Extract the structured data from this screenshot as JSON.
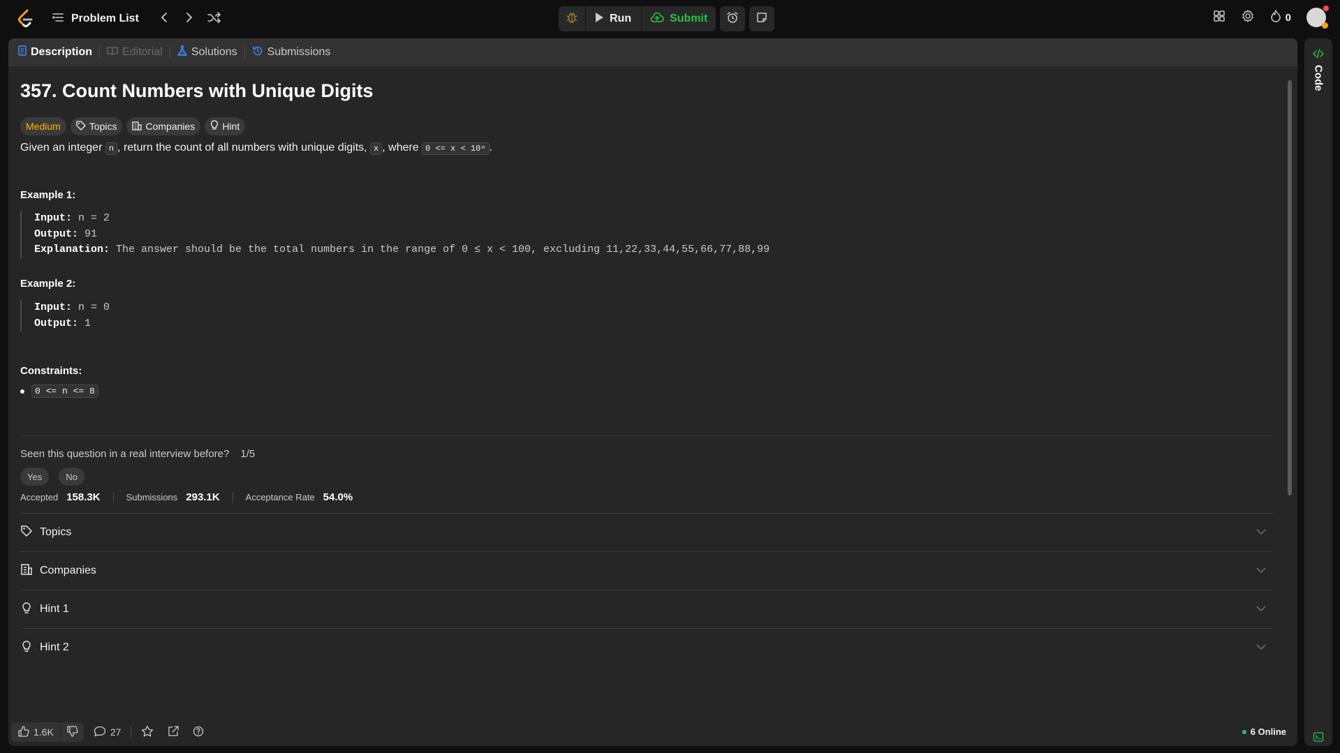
{
  "topbar": {
    "problem_list": "Problem List",
    "run": "Run",
    "submit": "Submit",
    "streak": "0",
    "icons": [
      "logo-icon",
      "list-icon",
      "prev-icon",
      "next-icon",
      "shuffle-icon",
      "debug-icon",
      "play-icon",
      "upload-icon",
      "alarm-icon",
      "note-icon",
      "grid-icon",
      "gear-icon",
      "fire-icon"
    ]
  },
  "tabs": [
    {
      "label": "Description",
      "state": "active"
    },
    {
      "label": "Editorial",
      "state": "disabled"
    },
    {
      "label": "Solutions",
      "state": "normal"
    },
    {
      "label": "Submissions",
      "state": "normal"
    }
  ],
  "problem": {
    "title": "357. Count Numbers with Unique Digits",
    "difficulty": "Medium",
    "chips": [
      "Topics",
      "Companies",
      "Hint"
    ],
    "desc_1": "Given an integer ",
    "desc_code_n": "n",
    "desc_2": ", return the count of all numbers with unique digits, ",
    "desc_code_x": "x",
    "desc_3": ", where ",
    "desc_code_range": "0 <= x < 10ⁿ",
    "desc_4": ".",
    "example1": {
      "title": "Example 1:",
      "input_label": "Input:",
      "input": " n = 2",
      "output_label": "Output:",
      "output": " 91",
      "expl_label": "Explanation:",
      "expl": " The answer should be the total numbers in the range of 0 ≤ x < 100, excluding 11,22,33,44,55,66,77,88,99"
    },
    "example2": {
      "title": "Example 2:",
      "input_label": "Input:",
      "input": " n = 0",
      "output_label": "Output:",
      "output": " 1"
    },
    "constraints_title": "Constraints:",
    "constraint": "0 <= n <= 8"
  },
  "interview": {
    "question": "Seen this question in a real interview before?",
    "fraction": "1/5",
    "yes": "Yes",
    "no": "No"
  },
  "stats": {
    "accepted_label": "Accepted",
    "accepted": "158.3K",
    "submissions_label": "Submissions",
    "submissions": "293.1K",
    "rate_label": "Acceptance Rate",
    "rate": "54.0%"
  },
  "accordions": [
    "Topics",
    "Companies",
    "Hint 1",
    "Hint 2"
  ],
  "bottom": {
    "likes": "1.6K",
    "comments": "27",
    "online": "6 Online"
  },
  "side": {
    "code_label": "Code"
  },
  "colors": {
    "accent_medium": "#ffb800",
    "submit_green": "#28c244",
    "online_green": "#2cbb5d",
    "panel_bg": "#262626"
  }
}
